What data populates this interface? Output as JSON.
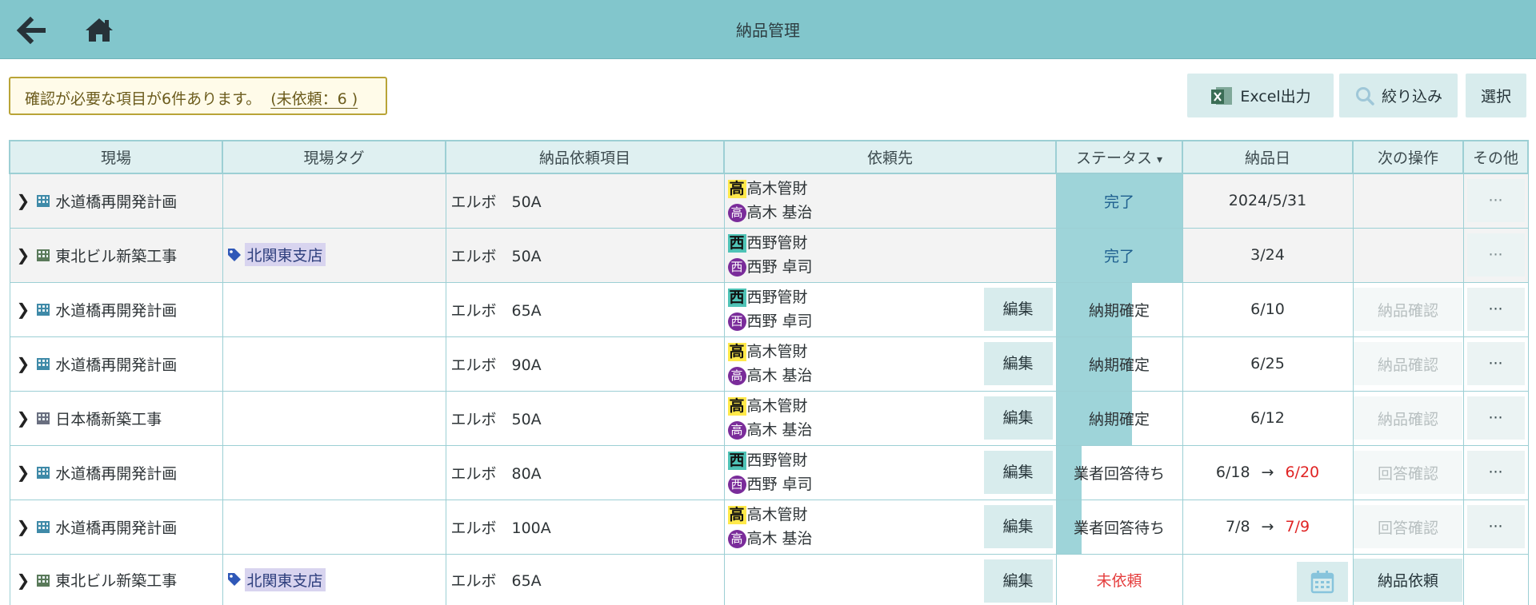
{
  "header": {
    "title": "納品管理",
    "back_icon": "arrow-left-icon",
    "home_icon": "home-icon"
  },
  "notice": {
    "text": "確認が必要な項目が6件あります。",
    "link": "(未依頼：6 )"
  },
  "toolbar": {
    "excel": "Excel出力",
    "filter": "絞り込み",
    "select": "選択"
  },
  "table": {
    "headers": [
      "現場",
      "現場タグ",
      "納品依頼項目",
      "依頼先",
      "ステータス",
      "納品日",
      "次の操作",
      "その他"
    ],
    "status_sort_icon": "▾",
    "rows": [
      {
        "site": "水道橋再開発計画",
        "tag": "",
        "item": "エルボ　50A",
        "company": "高木管財",
        "company_badge": "高",
        "person": "高木 基治",
        "person_badge": "高",
        "edit": "",
        "status": "完了",
        "date": "2024/5/31",
        "date_to": "",
        "next": "",
        "more": "···"
      },
      {
        "site": "東北ビル新築工事",
        "tag": "北関東支店",
        "item": "エルボ　50A",
        "company": "西野管財",
        "company_badge": "西",
        "person": "西野 卓司",
        "person_badge": "西",
        "edit": "",
        "status": "完了",
        "date": "3/24",
        "date_to": "",
        "next": "",
        "more": "···"
      },
      {
        "site": "水道橋再開発計画",
        "tag": "",
        "item": "エルボ　65A",
        "company": "西野管財",
        "company_badge": "西",
        "person": "西野 卓司",
        "person_badge": "西",
        "edit": "編集",
        "status": "納期確定",
        "date": "6/10",
        "date_to": "",
        "next": "納品確認",
        "more": "···"
      },
      {
        "site": "水道橋再開発計画",
        "tag": "",
        "item": "エルボ　90A",
        "company": "高木管財",
        "company_badge": "高",
        "person": "高木 基治",
        "person_badge": "高",
        "edit": "編集",
        "status": "納期確定",
        "date": "6/25",
        "date_to": "",
        "next": "納品確認",
        "more": "···"
      },
      {
        "site": "日本橋新築工事",
        "tag": "",
        "item": "エルボ　50A",
        "company": "高木管財",
        "company_badge": "高",
        "person": "高木 基治",
        "person_badge": "高",
        "edit": "編集",
        "status": "納期確定",
        "date": "6/12",
        "date_to": "",
        "next": "納品確認",
        "more": "···"
      },
      {
        "site": "水道橋再開発計画",
        "tag": "",
        "item": "エルボ　80A",
        "company": "西野管財",
        "company_badge": "西",
        "person": "西野 卓司",
        "person_badge": "西",
        "edit": "編集",
        "status": "業者回答待ち",
        "date": "6/18",
        "date_to": "6/20",
        "next": "回答確認",
        "more": "···"
      },
      {
        "site": "水道橋再開発計画",
        "tag": "",
        "item": "エルボ　100A",
        "company": "高木管財",
        "company_badge": "高",
        "person": "高木 基治",
        "person_badge": "高",
        "edit": "編集",
        "status": "業者回答待ち",
        "date": "7/8",
        "date_to": "7/9",
        "next": "回答確認",
        "more": "···"
      },
      {
        "site": "東北ビル新築工事",
        "tag": "北関東支店",
        "item": "エルボ　65A",
        "company": "",
        "company_badge": "",
        "person": "",
        "person_badge": "",
        "edit": "編集",
        "status": "未依頼",
        "date": "",
        "date_to": "",
        "next": "納品依頼",
        "more": ""
      }
    ],
    "arrow": "→"
  },
  "colors": {
    "header_bg": "#82c6cc",
    "status_fill": "#9ed4d9",
    "accent_red": "#e02424"
  }
}
